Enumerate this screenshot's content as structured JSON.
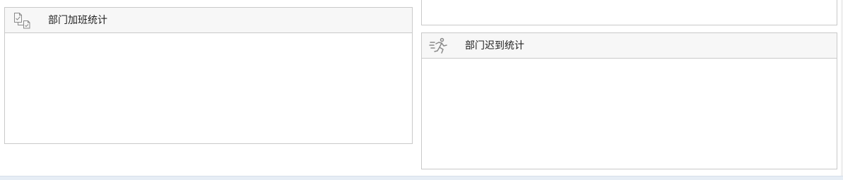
{
  "panels": {
    "overtime": {
      "title": "部门加班统计",
      "icon": "documents-check-icon"
    },
    "late": {
      "title": "部门迟到统计",
      "icon": "running-person-icon"
    }
  },
  "colors": {
    "border": "#c9c9c9",
    "header_bg": "#f7f7f7",
    "icon": "#8a8a8a",
    "bottom_bar": "#e6edf5"
  }
}
